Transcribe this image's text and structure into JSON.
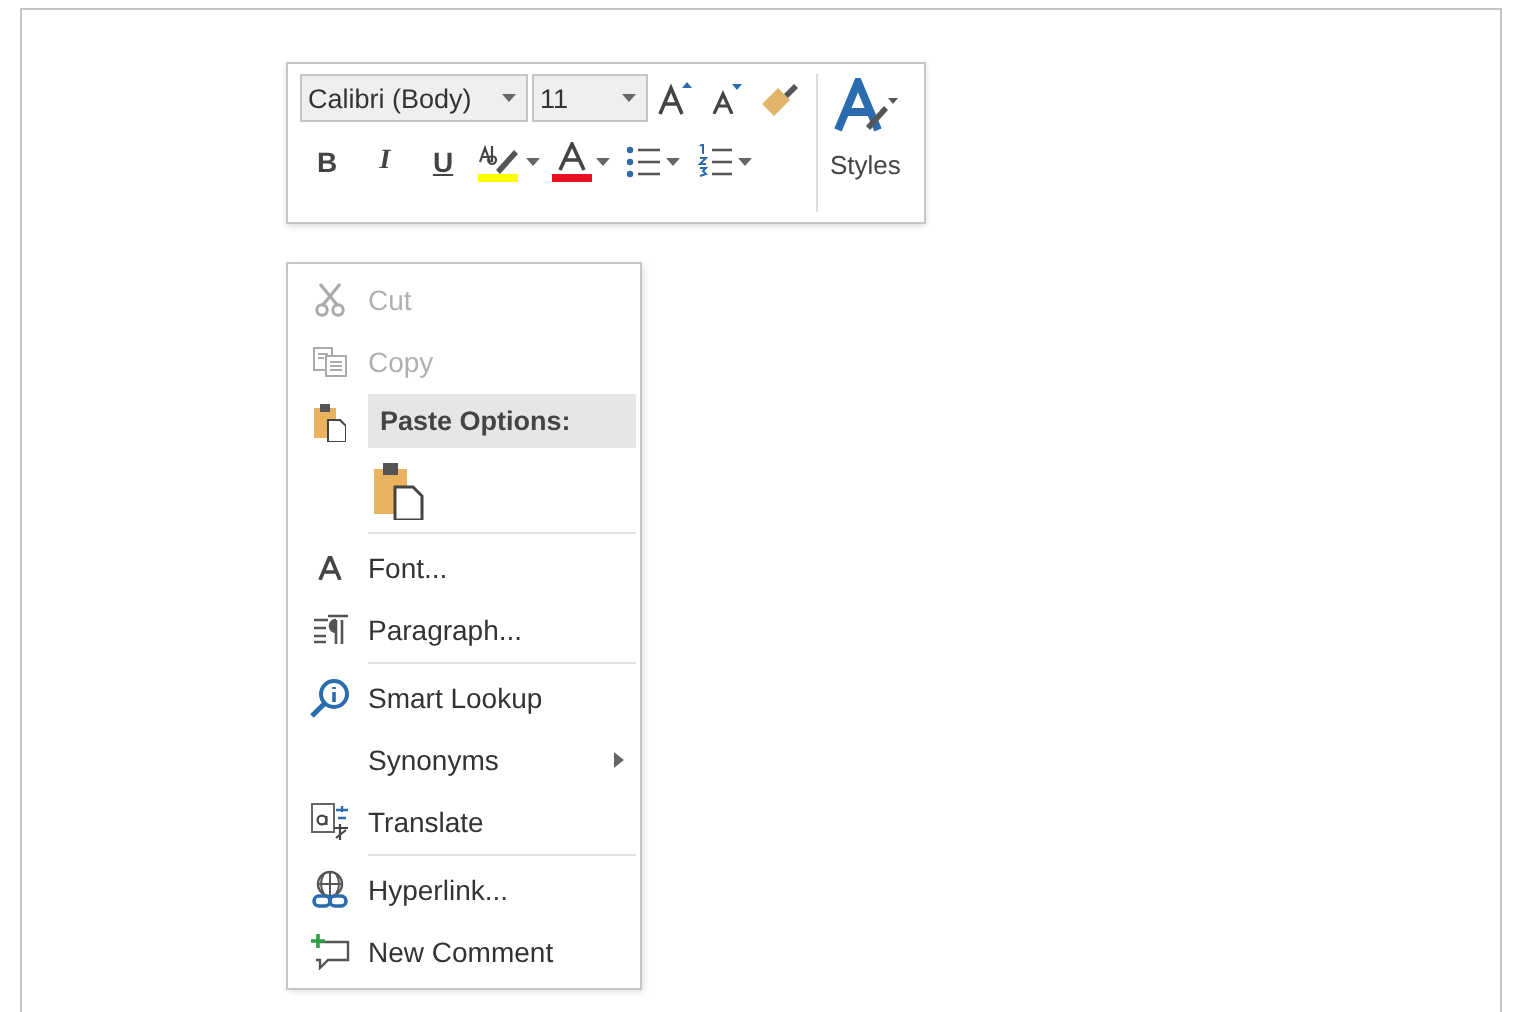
{
  "mini_toolbar": {
    "font_name": "Calibri (Body)",
    "font_size": "11",
    "styles_label": "Styles",
    "format_buttons": [
      {
        "kind": "bold",
        "label": "B"
      },
      {
        "kind": "italic",
        "label": "I"
      },
      {
        "kind": "underline",
        "label": "U"
      },
      {
        "kind": "highlight",
        "color": "#ffff00"
      },
      {
        "kind": "font-color",
        "color": "#e81123"
      },
      {
        "kind": "bullets"
      },
      {
        "kind": "numbering"
      }
    ]
  },
  "context_menu": {
    "items": [
      {
        "kind": "command",
        "label": "Cut",
        "disabled": true,
        "submenu": false
      },
      {
        "kind": "command",
        "label": "Copy",
        "disabled": true,
        "submenu": false
      },
      {
        "kind": "header",
        "label": "Paste Options:"
      },
      {
        "kind": "paste-options"
      },
      {
        "kind": "separator"
      },
      {
        "kind": "command",
        "label": "Font...",
        "disabled": false,
        "submenu": false
      },
      {
        "kind": "command",
        "label": "Paragraph...",
        "disabled": false,
        "submenu": false
      },
      {
        "kind": "separator"
      },
      {
        "kind": "command",
        "label": "Smart Lookup",
        "disabled": false,
        "submenu": false
      },
      {
        "kind": "command",
        "label": "Synonyms",
        "disabled": false,
        "submenu": true
      },
      {
        "kind": "command",
        "label": "Translate",
        "disabled": false,
        "submenu": false
      },
      {
        "kind": "separator"
      },
      {
        "kind": "command",
        "label": "Hyperlink...",
        "disabled": false,
        "submenu": false
      },
      {
        "kind": "command",
        "label": "New Comment",
        "disabled": false,
        "submenu": false
      }
    ]
  }
}
